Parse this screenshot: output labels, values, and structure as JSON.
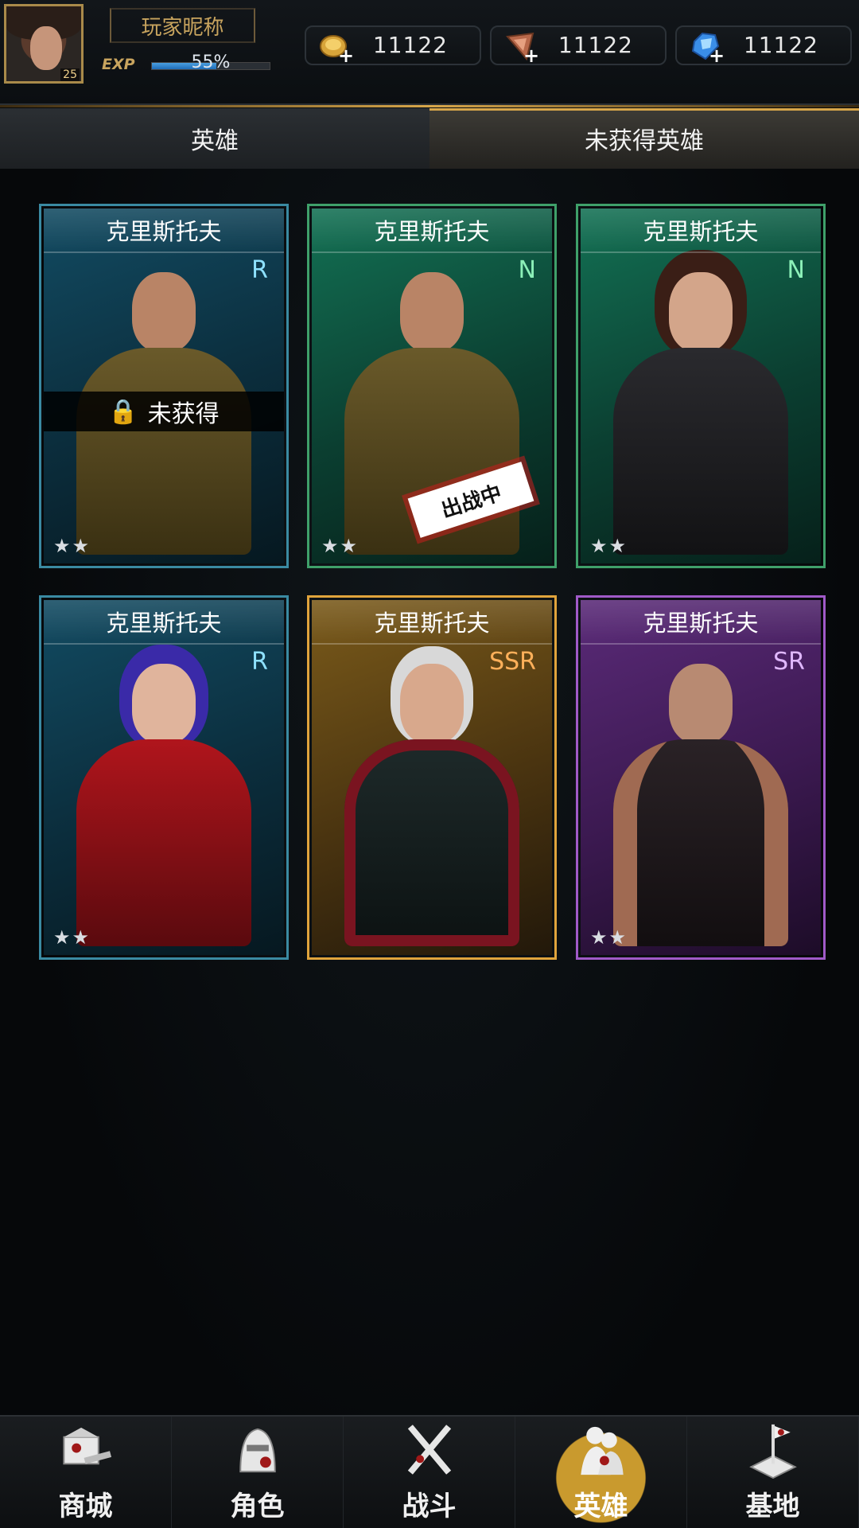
{
  "player": {
    "nickname": "玩家昵称",
    "level": "25",
    "exp_label": "EXP",
    "exp_percent_text": "55%",
    "exp_fraction": 0.55
  },
  "resources": [
    {
      "icon": "gold-coin-icon",
      "value": "11122"
    },
    {
      "icon": "ticket-icon",
      "value": "11122"
    },
    {
      "icon": "diamond-icon",
      "value": "11122"
    }
  ],
  "tabs": [
    {
      "label": "英雄",
      "active": false
    },
    {
      "label": "未获得英雄",
      "active": true
    }
  ],
  "heroes": [
    {
      "name": "克里斯托夫",
      "rarity": "R",
      "stars": "★★",
      "status": "未获得",
      "theme": "blue"
    },
    {
      "name": "克里斯托夫",
      "rarity": "N",
      "stars": "★★",
      "status": "出战中",
      "theme": "green"
    },
    {
      "name": "克里斯托夫",
      "rarity": "N",
      "stars": "★★",
      "status": "",
      "theme": "green"
    },
    {
      "name": "克里斯托夫",
      "rarity": "R",
      "stars": "★★",
      "status": "",
      "theme": "blue"
    },
    {
      "name": "克里斯托夫",
      "rarity": "SSR",
      "stars": "",
      "status": "",
      "theme": "gold"
    },
    {
      "name": "克里斯托夫",
      "rarity": "SR",
      "stars": "★★",
      "status": "",
      "theme": "purple"
    }
  ],
  "nav": [
    {
      "label": "商城",
      "icon": "shop-icon",
      "active": false
    },
    {
      "label": "角色",
      "icon": "character-icon",
      "active": false
    },
    {
      "label": "战斗",
      "icon": "crossed-rifles-icon",
      "active": false
    },
    {
      "label": "英雄",
      "icon": "heroes-icon",
      "active": true
    },
    {
      "label": "基地",
      "icon": "base-flag-icon",
      "active": false
    }
  ]
}
